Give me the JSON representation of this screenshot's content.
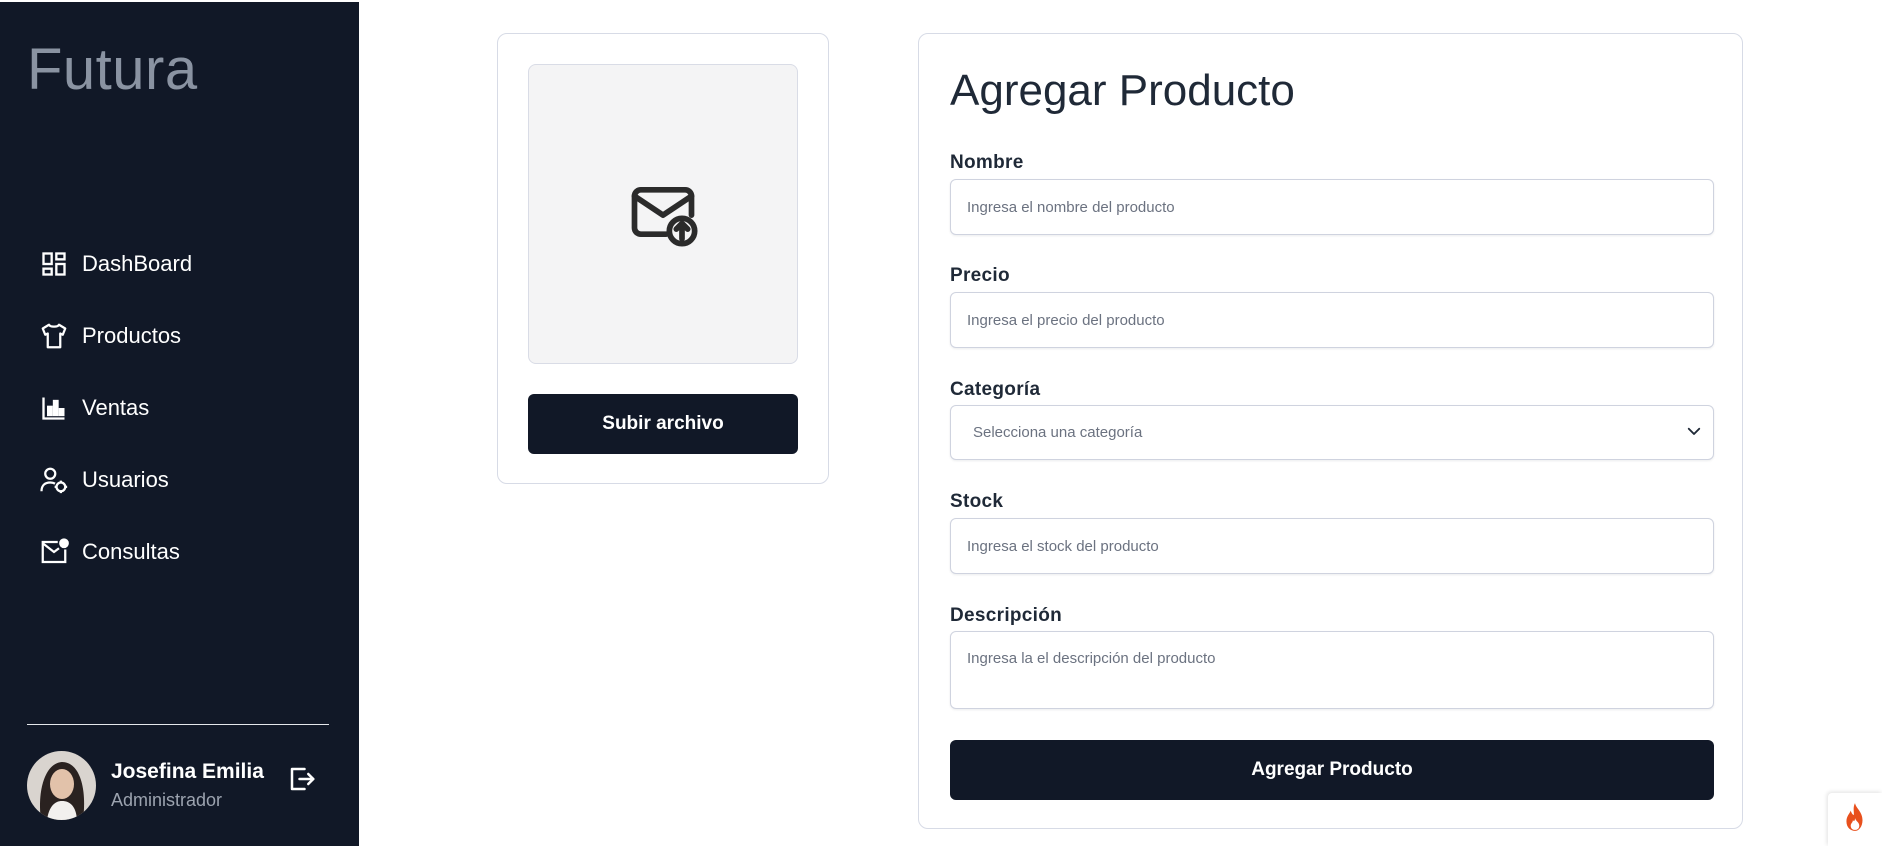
{
  "sidebar": {
    "brand": "Futura",
    "items": [
      {
        "label": "DashBoard",
        "icon": "dashboard-icon"
      },
      {
        "label": "Productos",
        "icon": "shirt-icon"
      },
      {
        "label": "Ventas",
        "icon": "bar-chart-icon"
      },
      {
        "label": "Usuarios",
        "icon": "user-settings-icon"
      },
      {
        "label": "Consultas",
        "icon": "mail-notification-icon"
      }
    ],
    "user": {
      "name": "Josefina Emilia",
      "role": "Administrador"
    }
  },
  "upload": {
    "icon": "mail-upload-icon",
    "button_label": "Subir archivo"
  },
  "form": {
    "title": "Agregar Producto",
    "fields": {
      "nombre": {
        "label": "Nombre",
        "placeholder": "Ingresa el nombre del producto"
      },
      "precio": {
        "label": "Precio",
        "placeholder": "Ingresa el precio del producto"
      },
      "categoria": {
        "label": "Categoría",
        "selected": "Selecciona una categoría"
      },
      "stock": {
        "label": "Stock",
        "placeholder": "Ingresa el stock del producto"
      },
      "descripcion": {
        "label": "Descripción",
        "placeholder": "Ingresa la el descripción del producto"
      }
    },
    "submit_label": "Agregar Producto"
  },
  "colors": {
    "sidebar_bg": "#111827",
    "button_bg": "#111827",
    "accent_flame": "#e8501d"
  }
}
